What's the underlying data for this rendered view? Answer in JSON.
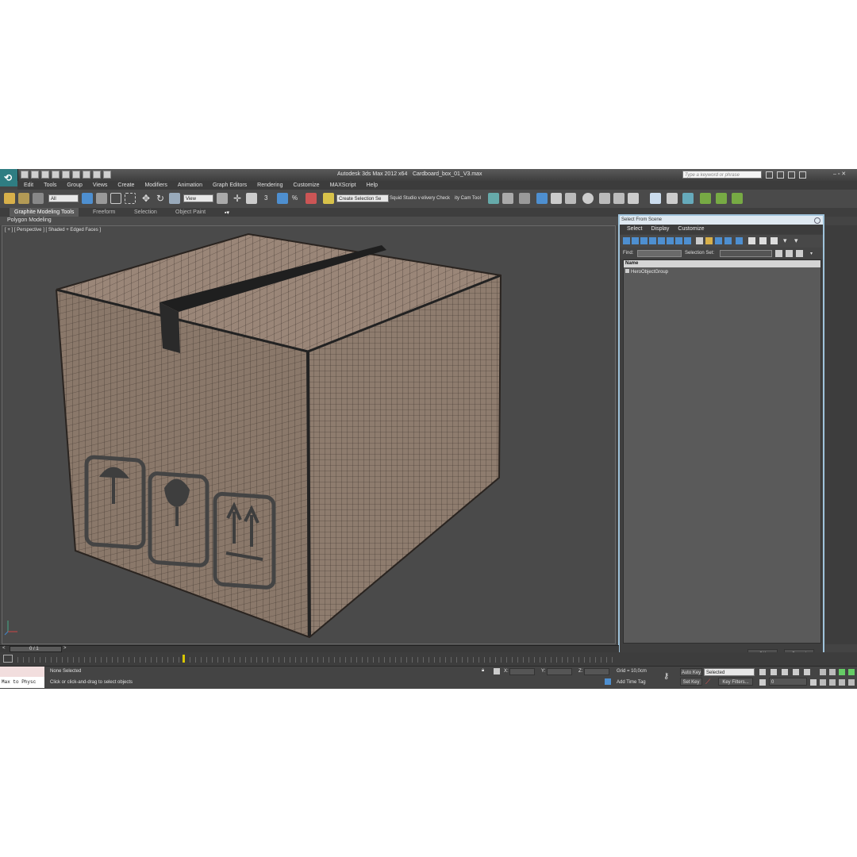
{
  "window": {
    "app_title": "Autodesk 3ds Max  2012 x64",
    "file_name": "Cardboard_box_01_V3.max",
    "search_placeholder": "Type a keyword or phrase",
    "logo": "3ds-max-logo"
  },
  "menu": [
    "Edit",
    "Tools",
    "Group",
    "Views",
    "Create",
    "Modifiers",
    "Animation",
    "Graph Editors",
    "Rendering",
    "Customize",
    "MAXScript",
    "Help"
  ],
  "toolbar": {
    "selection_filter": "All",
    "reference_coord": "View",
    "named_selection": "Create Selection Se",
    "squid_label": "Squid Studio v",
    "delivery_label": "elivery Check",
    "unity_label": "ity Cam Tool",
    "snap_label": "3",
    "percent_label": "%"
  },
  "ribbon": {
    "tabs": [
      "Graphite Modeling Tools",
      "Freeform",
      "Selection",
      "Object Paint"
    ],
    "active_tab": "Graphite Modeling Tools",
    "panel": "Polygon Modeling"
  },
  "viewport": {
    "label": "[ + ] [ Perspective ] [ Shaded + Edged Faces ]",
    "object": "cardboard box with tape and handling symbols",
    "box_color": "#8a786a",
    "wire_color": "#3a302a"
  },
  "dialog": {
    "title": "Select From Scene",
    "menu": [
      "Select",
      "Display",
      "Customize"
    ],
    "find_label": "Find:",
    "find_value": "",
    "selection_set_label": "Selection Set:",
    "selection_set_value": "",
    "column_header": "Name",
    "items": [
      "HeroObjectGroup"
    ],
    "ok_label": "OK",
    "cancel_label": "Cancel"
  },
  "timeslider": {
    "frame": "0 / 1"
  },
  "status": {
    "maxscript_input": "Max to Physc",
    "selection": "None Selected",
    "prompt": "Click or click-and-drag to select objects",
    "x_label": "X:",
    "y_label": "Y:",
    "z_label": "Z:",
    "grid": "Grid = 10,0cm",
    "add_time_tag": "Add Time Tag",
    "auto_key": "Auto Key",
    "auto_key_mode": "Selected",
    "set_key": "Set Key",
    "key_filters": "Key Filters...",
    "current_frame": "0"
  }
}
